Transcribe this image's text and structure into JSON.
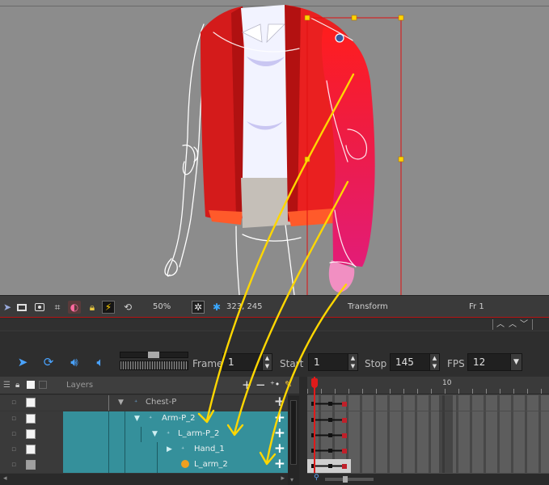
{
  "toolbar": {
    "zoom": "50%",
    "coords": "323, 245",
    "mode_label": "Transform",
    "frame_indicator": "Fr 1"
  },
  "playback": {
    "frame_label": "Frame",
    "frame_value": "1",
    "start_label": "Start",
    "start_value": "1",
    "stop_label": "Stop",
    "stop_value": "145",
    "fps_label": "FPS",
    "fps_value": "12"
  },
  "layers": {
    "header_label": "Layers",
    "rows": [
      {
        "name": "Chest-P"
      },
      {
        "name": "Arm-P_2"
      },
      {
        "name": "L_arm-P_2"
      },
      {
        "name": "Hand_1"
      },
      {
        "name": "L_arm_2"
      }
    ]
  },
  "frames": {
    "ruler_mark": "10"
  },
  "colors": {
    "selected_layer": "#35909b",
    "annotation_arrows": "#ffd700",
    "keyframe": "#c0202a"
  }
}
